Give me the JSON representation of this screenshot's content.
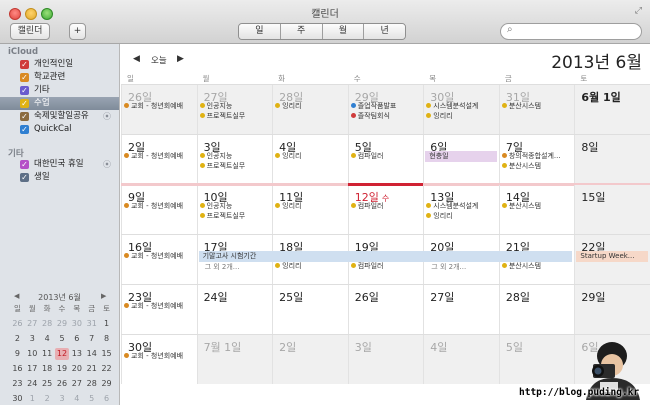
{
  "window": {
    "title": "캘린더"
  },
  "toolbar": {
    "calendars_label": "캘린더",
    "add_label": "+",
    "views": [
      {
        "label": "일",
        "active": false
      },
      {
        "label": "주",
        "active": false
      },
      {
        "label": "월",
        "active": true
      },
      {
        "label": "년",
        "active": false
      }
    ],
    "search_placeholder": "",
    "search_icon": "search-icon",
    "fullscreen_icon": "fullscreen-arrows-icon"
  },
  "sidebar": {
    "icloud_header": "iCloud",
    "other_header": "기타",
    "icloud_items": [
      {
        "label": "개인적인일",
        "color": "#cf3b3b",
        "checked": true,
        "selected": false,
        "shared": false
      },
      {
        "label": "학교관련",
        "color": "#d98a22",
        "checked": true,
        "selected": false,
        "shared": false
      },
      {
        "label": "기타",
        "color": "#6a5bcf",
        "checked": true,
        "selected": false,
        "shared": false
      },
      {
        "label": "수업",
        "color": "#e0b214",
        "checked": true,
        "selected": true,
        "shared": false
      },
      {
        "label": "숙제및할일공유",
        "color": "#8b6b3e",
        "checked": true,
        "selected": false,
        "shared": true
      },
      {
        "label": "QuickCal",
        "color": "#2f7fd1",
        "checked": true,
        "selected": false,
        "shared": false
      }
    ],
    "other_items": [
      {
        "label": "대한민국 휴일",
        "color": "#b44fc7",
        "checked": true,
        "shared": true
      },
      {
        "label": "생일",
        "color": "#5d6f86",
        "checked": true,
        "shared": false
      }
    ],
    "mini_calendar": {
      "title": "2013년 6월",
      "prev_glyph": "◀",
      "next_glyph": "▶",
      "weekdays": [
        "일",
        "월",
        "화",
        "수",
        "목",
        "금",
        "토"
      ],
      "weeks": [
        [
          "26",
          "27",
          "28",
          "29",
          "30",
          "31",
          "1"
        ],
        [
          "2",
          "3",
          "4",
          "5",
          "6",
          "7",
          "8"
        ],
        [
          "9",
          "10",
          "11",
          "12",
          "13",
          "14",
          "15"
        ],
        [
          "16",
          "17",
          "18",
          "19",
          "20",
          "21",
          "22"
        ],
        [
          "23",
          "24",
          "25",
          "26",
          "27",
          "28",
          "29"
        ],
        [
          "30",
          "1",
          "2",
          "3",
          "4",
          "5",
          "6"
        ]
      ],
      "today": "12"
    }
  },
  "main": {
    "prev_glyph": "◀",
    "today_label": "오늘",
    "next_glyph": "▶",
    "month_title": "2013년 6월",
    "weekdays": [
      "일",
      "월",
      "화",
      "수",
      "목",
      "금",
      "토"
    ],
    "weeks": [
      {
        "days": [
          {
            "num": "26일",
            "other": true
          },
          {
            "num": "27일",
            "other": true
          },
          {
            "num": "28일",
            "other": true
          },
          {
            "num": "29일",
            "other": true
          },
          {
            "num": "30일",
            "other": true
          },
          {
            "num": "31일",
            "other": true
          },
          {
            "num": "6월 1일",
            "bold": true
          }
        ],
        "events": [
          {
            "col": 0,
            "line": 0,
            "text": "교회 - 청년회예배",
            "color": "#d98a22"
          },
          {
            "col": 1,
            "line": 0,
            "text": "인공지능",
            "color": "#e0b214"
          },
          {
            "col": 1,
            "line": 1,
            "text": "프로젝트실무",
            "color": "#e0b214"
          },
          {
            "col": 2,
            "line": 0,
            "text": "잉리리",
            "color": "#e0b214"
          },
          {
            "col": 3,
            "line": 0,
            "text": "졸업작품발표",
            "color": "#2f7fd1"
          },
          {
            "col": 3,
            "line": 1,
            "text": "졸작팀회식",
            "color": "#cf3b3b"
          },
          {
            "col": 4,
            "line": 0,
            "text": "시스템분석설계",
            "color": "#e0b214"
          },
          {
            "col": 4,
            "line": 1,
            "text": "잉리리",
            "color": "#e0b214"
          },
          {
            "col": 5,
            "line": 0,
            "text": "분산시스템",
            "color": "#e0b214"
          }
        ]
      },
      {
        "days": [
          {
            "num": "2일"
          },
          {
            "num": "3일"
          },
          {
            "num": "4일"
          },
          {
            "num": "5일"
          },
          {
            "num": "6일"
          },
          {
            "num": "7일"
          },
          {
            "num": "8일"
          }
        ],
        "events": [
          {
            "col": 0,
            "line": 0,
            "text": "교회 - 청년회예배",
            "color": "#d98a22"
          },
          {
            "col": 1,
            "line": 0,
            "text": "인공지능",
            "color": "#e0b214"
          },
          {
            "col": 1,
            "line": 1,
            "text": "프로젝트실무",
            "color": "#e0b214"
          },
          {
            "col": 2,
            "line": 0,
            "text": "잉리리",
            "color": "#e0b214"
          },
          {
            "col": 3,
            "line": 0,
            "text": "컴파일러",
            "color": "#e0b214"
          },
          {
            "col": 5,
            "line": 0,
            "text": "창의적종합설계...",
            "color": "#d98a22"
          },
          {
            "col": 5,
            "line": 1,
            "text": "분산시스템",
            "color": "#e0b214"
          }
        ],
        "allday": [
          {
            "col": 4,
            "span": 1,
            "line": 0,
            "text": "현충일",
            "bg": "#e6d2ec",
            "fg": "#333"
          }
        ]
      },
      {
        "days": [
          {
            "num": "9일"
          },
          {
            "num": "10일"
          },
          {
            "num": "11일"
          },
          {
            "num": "12일",
            "today": true,
            "suffix": "수"
          },
          {
            "num": "13일"
          },
          {
            "num": "14일"
          },
          {
            "num": "15일"
          }
        ],
        "events": [
          {
            "col": 0,
            "line": 0,
            "text": "교회 - 청년회예배",
            "color": "#d98a22"
          },
          {
            "col": 1,
            "line": 0,
            "text": "인공지능",
            "color": "#e0b214"
          },
          {
            "col": 1,
            "line": 1,
            "text": "프로젝트실무",
            "color": "#e0b214"
          },
          {
            "col": 2,
            "line": 0,
            "text": "잉리리",
            "color": "#e0b214"
          },
          {
            "col": 3,
            "line": 0,
            "text": "컴파일러",
            "color": "#e0b214"
          },
          {
            "col": 4,
            "line": 0,
            "text": "시스템분석설계",
            "color": "#e0b214"
          },
          {
            "col": 4,
            "line": 1,
            "text": "잉리리",
            "color": "#e0b214"
          },
          {
            "col": 5,
            "line": 0,
            "text": "분산시스템",
            "color": "#e0b214"
          }
        ]
      },
      {
        "days": [
          {
            "num": "16일"
          },
          {
            "num": "17일"
          },
          {
            "num": "18일"
          },
          {
            "num": "19일"
          },
          {
            "num": "20일"
          },
          {
            "num": "21일"
          },
          {
            "num": "22일"
          }
        ],
        "events": [
          {
            "col": 0,
            "line": 0,
            "text": "교회 - 청년회예배",
            "color": "#d98a22"
          },
          {
            "col": 2,
            "line": 1,
            "text": "잉리리",
            "color": "#e0b214"
          },
          {
            "col": 3,
            "line": 1,
            "text": "컴파일러",
            "color": "#e0b214"
          },
          {
            "col": 5,
            "line": 1,
            "text": "분산시스템",
            "color": "#e0b214"
          }
        ],
        "more": [
          {
            "col": 1,
            "line": 1,
            "text": "그 외 2개..."
          },
          {
            "col": 4,
            "line": 1,
            "text": "그 외 2개..."
          }
        ],
        "allday": [
          {
            "col": 1,
            "span": 5,
            "line": 0,
            "text": "기말고사 시험기간",
            "bg": "#cfdff0",
            "fg": "#333"
          },
          {
            "col": 6,
            "span": 1,
            "line": 0,
            "text": "Startup Week...",
            "bg": "#f6d8c8",
            "fg": "#333"
          }
        ]
      },
      {
        "days": [
          {
            "num": "23일"
          },
          {
            "num": "24일"
          },
          {
            "num": "25일"
          },
          {
            "num": "26일"
          },
          {
            "num": "27일"
          },
          {
            "num": "28일"
          },
          {
            "num": "29일"
          }
        ],
        "events": [
          {
            "col": 0,
            "line": 0,
            "text": "교회 - 청년회예배",
            "color": "#d98a22"
          }
        ]
      },
      {
        "days": [
          {
            "num": "30일"
          },
          {
            "num": "7월 1일",
            "other": true
          },
          {
            "num": "2일",
            "other": true
          },
          {
            "num": "3일",
            "other": true
          },
          {
            "num": "4일",
            "other": true
          },
          {
            "num": "5일",
            "other": true
          },
          {
            "num": "6일",
            "other": true
          }
        ],
        "events": [
          {
            "col": 0,
            "line": 0,
            "text": "교회 - 청년회예배",
            "color": "#d98a22"
          }
        ]
      }
    ]
  },
  "watermark": "http://blog.puding.kr"
}
